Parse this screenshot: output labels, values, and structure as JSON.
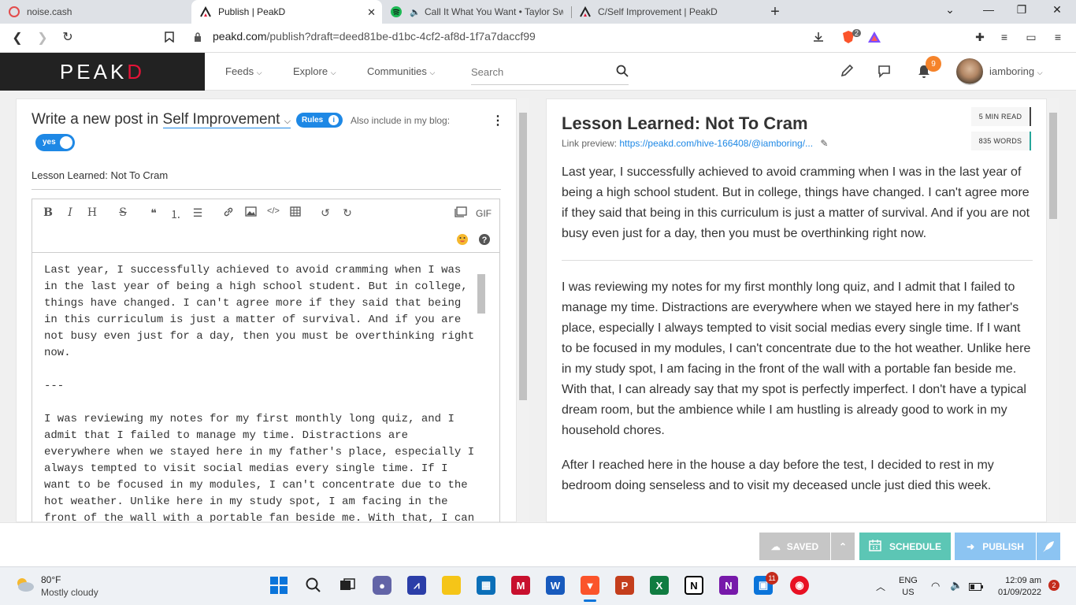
{
  "browser": {
    "tabs": [
      {
        "title": "noise.cash",
        "active": false
      },
      {
        "title": "Publish | PeakD",
        "active": true
      },
      {
        "title": "Call It What You Want • Taylor Swif",
        "active": false
      },
      {
        "title": "C/Self Improvement | PeakD",
        "active": false
      }
    ],
    "new_tab": "+",
    "url_host": "peakd.com",
    "url_path": "/publish?draft=deed81be-d1bc-4cf2-af8d-1f7a7daccf99",
    "brave_badge": "2"
  },
  "header": {
    "logo_a": "PE",
    "logo_b": "AK",
    "logo_c": "D",
    "nav": [
      "Feeds",
      "Explore",
      "Communities"
    ],
    "search_placeholder": "Search",
    "notifications": "9",
    "username": "iamboring"
  },
  "editor": {
    "title_prefix": "Write a new post in",
    "community": "Self Improvement",
    "rules": "Rules",
    "also_include": "Also include in my blog:",
    "toggle": "yes",
    "post_title": "Lesson Learned: Not To Cram",
    "toolbar": {
      "bold": "B",
      "italic": "I",
      "heading": "H",
      "strike": "S",
      "quote": "❝",
      "gif": "GIF"
    },
    "body": "Last year, I successfully achieved to avoid cramming when I was in the last year of being a high school student. But in college, things have changed. I can't agree more if they said that being in this curriculum is just a matter of survival. And if you are not busy even just for a day, then you must be overthinking right now.\n\n---\n\nI was reviewing my notes for my first monthly long quiz, and I admit that I failed to manage my time. Distractions are everywhere when we stayed here in my father's place, especially I always tempted to visit social medias every single time. If I want to be focused in my modules, I can't concentrate due to the hot weather. Unlike here in my study spot, I am facing in the front of the wall with a portable fan beside me. With that, I can"
  },
  "preview": {
    "title": "Lesson Learned: Not To Cram",
    "link_label": "Link preview:",
    "link": "https://peakd.com/hive-166408/@iamboring/...",
    "read_time": "5 MIN READ",
    "words": "835 WORDS",
    "p1": "Last year, I successfully achieved to avoid cramming when I was in the last year of being a high school student. But in college, things have changed. I can't agree more if they said that being in this curriculum is just a matter of survival. And if you are not busy even just for a day, then you must be overthinking right now.",
    "p2": "I was reviewing my notes for my first monthly long quiz, and I admit that I failed to manage my time. Distractions are everywhere when we stayed here in my father's place, especially I always tempted to visit social medias every single time. If I want to be focused in my modules, I can't concentrate due to the hot weather. Unlike here in my study spot, I am facing in the front of the wall with a portable fan beside me. With that, I can already say that my spot is perfectly imperfect. I don't have a typical dream room, but the ambience while I am hustling is already good to work in my household chores.",
    "p3": "After I reached here in the house a day before the test, I decided to rest in my bedroom doing senseless and to visit my deceased uncle just died this week."
  },
  "actions": {
    "saved": "SAVED",
    "schedule": "SCHEDULE",
    "publish": "PUBLISH"
  },
  "taskbar": {
    "temperature": "80°F",
    "weather": "Mostly cloudy",
    "lang1": "ENG",
    "lang2": "US",
    "time": "12:09 am",
    "date": "01/09/2022",
    "notifications": "2",
    "onenote_badge": "11"
  },
  "colors": {
    "accent": "#1e88e5",
    "brand_red": "#e31337",
    "saved_gray": "#c6c6c6",
    "schedule_teal": "#5cc6b5",
    "publish_blue": "#8cc4f2"
  }
}
